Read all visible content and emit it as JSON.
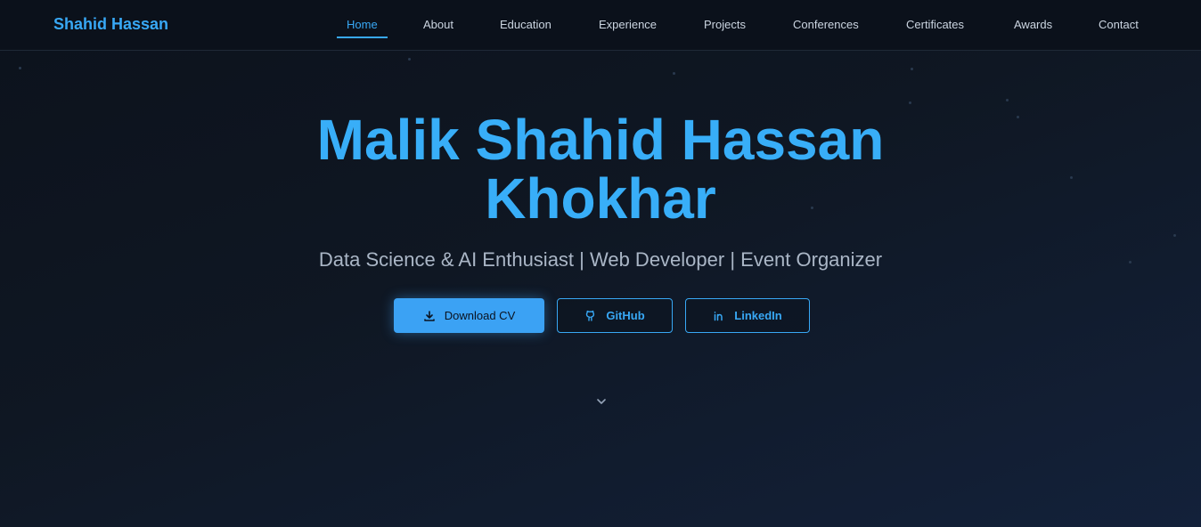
{
  "brand": "Shahid Hassan",
  "nav": {
    "items": [
      {
        "label": "Home",
        "active": true
      },
      {
        "label": "About"
      },
      {
        "label": "Education"
      },
      {
        "label": "Experience"
      },
      {
        "label": "Projects"
      },
      {
        "label": "Conferences"
      },
      {
        "label": "Certificates"
      },
      {
        "label": "Awards"
      },
      {
        "label": "Contact"
      }
    ]
  },
  "hero": {
    "title_line1": "Malik Shahid Hassan",
    "title_line2": "Khokhar",
    "subtitle": "Data Science & AI Enthusiast | Web Developer | Event Organizer"
  },
  "buttons": {
    "download": {
      "label": "Download CV",
      "icon": "download-icon"
    },
    "github": {
      "label": "GitHub",
      "icon": "github-icon"
    },
    "linkedin": {
      "label": "LinkedIn",
      "icon": "linkedin-icon"
    }
  },
  "scroll": {
    "icon": "chevron-down-icon"
  },
  "colors": {
    "accent": "#38a8f5",
    "background": "#0f1723",
    "nav_background": "#0b111b"
  }
}
